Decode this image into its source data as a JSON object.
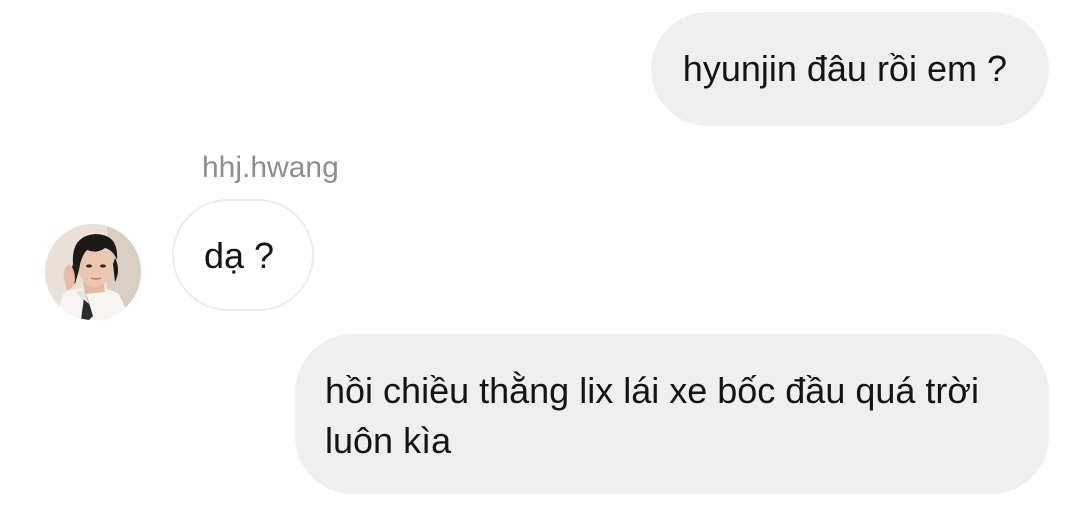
{
  "conversation": {
    "messages": [
      {
        "direction": "outgoing",
        "text": "hyunjin đâu rồi em ?"
      },
      {
        "direction": "incoming",
        "sender": "hhj.hwang",
        "text": "dạ ?"
      },
      {
        "direction": "outgoing",
        "text": "hồi chiều thằng lix lái xe bốc đầu quá trời luôn kìa"
      }
    ]
  },
  "colors": {
    "outgoing_bubble": "#efefef",
    "incoming_bubble_border": "#ececec",
    "sender_name": "#8e8e8e",
    "message_text": "#141414"
  },
  "icons": {
    "avatar": "profile-photo"
  }
}
